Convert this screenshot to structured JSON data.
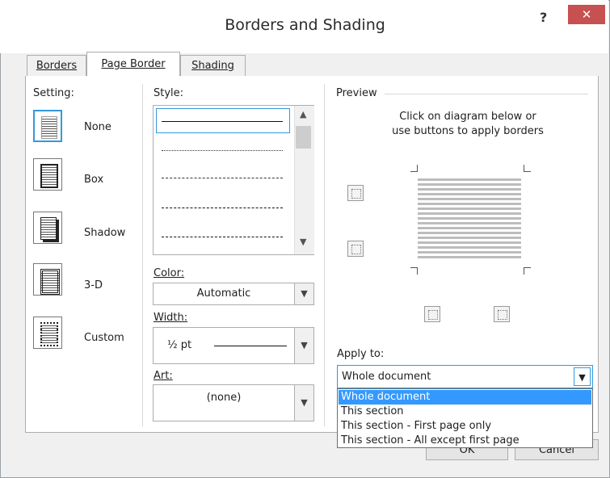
{
  "window": {
    "title": "Borders and Shading",
    "help_label": "?",
    "close_label": "✕"
  },
  "tabs": [
    {
      "label": "Borders",
      "active": false
    },
    {
      "label": "Page Border",
      "active": true
    },
    {
      "label": "Shading",
      "active": false
    }
  ],
  "setting": {
    "heading": "Setting:",
    "options": [
      {
        "label": "None",
        "selected": true,
        "icon": "setting-none-icon"
      },
      {
        "label": "Box",
        "selected": false,
        "icon": "setting-box-icon"
      },
      {
        "label": "Shadow",
        "selected": false,
        "icon": "setting-shadow-icon"
      },
      {
        "label": "3-D",
        "selected": false,
        "icon": "setting-3d-icon"
      },
      {
        "label": "Custom",
        "selected": false,
        "icon": "setting-custom-icon"
      }
    ]
  },
  "style": {
    "heading": "Style:",
    "options": [
      "solid",
      "dotted",
      "dashed-fine",
      "dashed",
      "dash-dot"
    ],
    "selected": "solid"
  },
  "color": {
    "label": "Color:",
    "value": "Automatic"
  },
  "width": {
    "label": "Width:",
    "value": "½ pt"
  },
  "art": {
    "label": "Art:",
    "value": "(none)"
  },
  "preview": {
    "heading": "Preview",
    "instructions_line1": "Click on diagram below or",
    "instructions_line2": "use buttons to apply borders"
  },
  "apply_to": {
    "label": "Apply to:",
    "value": "Whole document",
    "options": [
      {
        "label": "Whole document",
        "highlighted": true
      },
      {
        "label": "This section",
        "highlighted": false
      },
      {
        "label": "This section - First page only",
        "highlighted": false
      },
      {
        "label": "This section - All except first page",
        "highlighted": false
      }
    ]
  },
  "buttons": {
    "ok": "OK",
    "cancel": "Cancel"
  },
  "colors": {
    "accent": "#3399dd",
    "highlight": "#3399ff",
    "close": "#c75050"
  }
}
